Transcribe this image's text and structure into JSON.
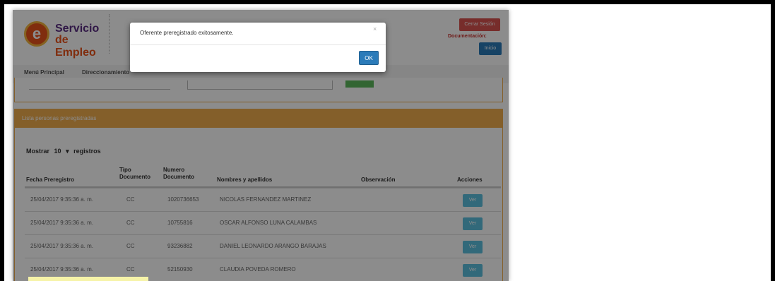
{
  "header": {
    "logo_line1": "Servicio",
    "logo_line2": "de Empleo",
    "logo_letter": "e",
    "logout_label": "Cerrar Sesión",
    "doc_label": "Documentación:",
    "home_label": "Inicio"
  },
  "nav": {
    "items": [
      "Menú Principal",
      "Direccionamiento"
    ]
  },
  "list": {
    "title": "Lista personas preregistradas",
    "show_prefix": "Mostrar",
    "show_value": "10",
    "show_caret": "▾",
    "show_suffix": "registros",
    "columns": {
      "fecha": "Fecha Preregistro",
      "tipo1": "Tipo",
      "tipo2": "Documento",
      "numero1": "Numero",
      "numero2": "Documento",
      "nombres": "Nombres y apellidos",
      "observacion": "Observación",
      "acciones": "Acciones"
    },
    "rows": [
      {
        "fecha": "25/04/2017 9:35:36 a. m.",
        "tipo": "CC",
        "numero": "1020736653",
        "nombre": "NICOLAS FERNANDEZ MARTINEZ",
        "accion": "Ver"
      },
      {
        "fecha": "25/04/2017 9:35:36 a. m.",
        "tipo": "CC",
        "numero": "10755816",
        "nombre": "OSCAR ALFONSO LUNA CALAMBAS",
        "accion": "Ver"
      },
      {
        "fecha": "25/04/2017 9:35:36 a. m.",
        "tipo": "CC",
        "numero": "93236882",
        "nombre": "DANIEL LEONARDO ARANGO BARAJAS",
        "accion": "Ver"
      },
      {
        "fecha": "25/04/2017 9:35:36 a. m.",
        "tipo": "CC",
        "numero": "52150930",
        "nombre": "CLAUDIA POVEDA ROMERO",
        "accion": "Ver"
      }
    ]
  },
  "modal": {
    "message": "Oferente preregistrado exitosamente.",
    "close_symbol": "×",
    "ok_label": "OK"
  },
  "colors": {
    "accent_orange": "#f0ad4e",
    "ok_blue": "#2b7bb9",
    "ver_blue": "#5bc0de",
    "logout_red": "#d9534f"
  }
}
